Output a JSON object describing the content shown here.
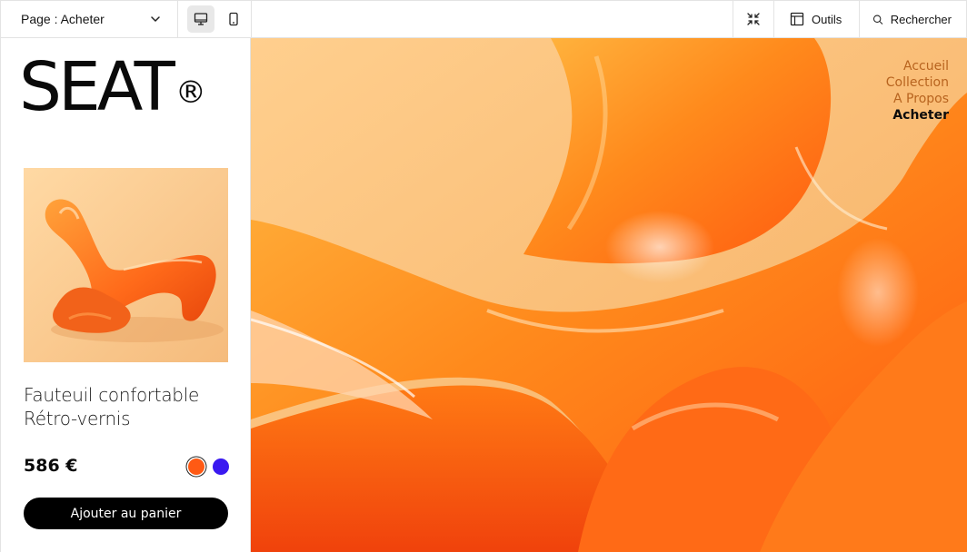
{
  "toolbar": {
    "page_select_label": "Page : Acheter",
    "tools_label": "Outils",
    "search_label": "Rechercher"
  },
  "brand": {
    "name": "SEAT",
    "mark": "®"
  },
  "product": {
    "name_line1": "Fauteuil confortable",
    "name_line2": "Rétro-vernis",
    "price": "586 €",
    "add_to_cart_label": "Ajouter au panier",
    "swatches": [
      {
        "name": "orange",
        "color": "#ff5a14",
        "selected": true
      },
      {
        "name": "blue",
        "color": "#3a19f0",
        "selected": false
      }
    ]
  },
  "nav": {
    "items": [
      "Accueil",
      "Collection",
      "A Propos",
      "Acheter"
    ],
    "current": "Acheter"
  },
  "colors": {
    "accent_orange": "#ff7a12",
    "nav_inactive": "#b8641f",
    "button_bg": "#000000"
  },
  "icons": {
    "desktop": "desktop-icon",
    "mobile": "mobile-icon",
    "collapse": "collapse-icon",
    "tools": "panel-icon",
    "search": "search-icon",
    "chevron": "chevron-down-icon"
  }
}
